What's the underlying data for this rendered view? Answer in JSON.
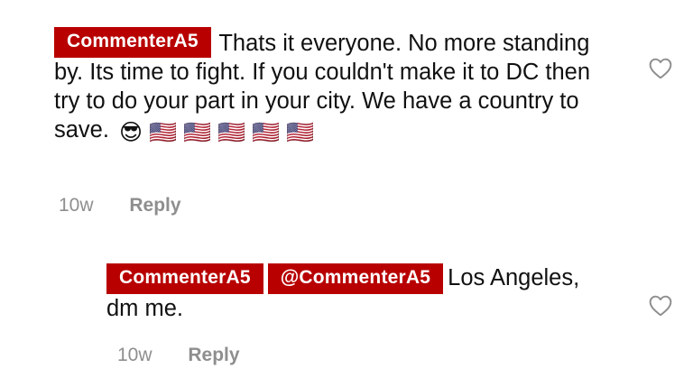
{
  "comments": [
    {
      "user": "CommenterA5",
      "text": "Thats it everyone. No more standing by. Its time to fight. If you couldn't make it to DC then try to do your part in your city. We have a country to save.",
      "emoji": "😎 🇺🇸 🇺🇸 🇺🇸 🇺🇸 🇺🇸",
      "time": "10w",
      "reply_label": "Reply"
    },
    {
      "user": "CommenterA5",
      "mention": "@CommenterA5",
      "text": "Los Angeles, dm me.",
      "time": "10w",
      "reply_label": "Reply"
    }
  ],
  "colors": {
    "tag_bg": "#b80000",
    "meta": "#8e8e8e"
  },
  "icons": {
    "like": "heart-outline-icon"
  }
}
